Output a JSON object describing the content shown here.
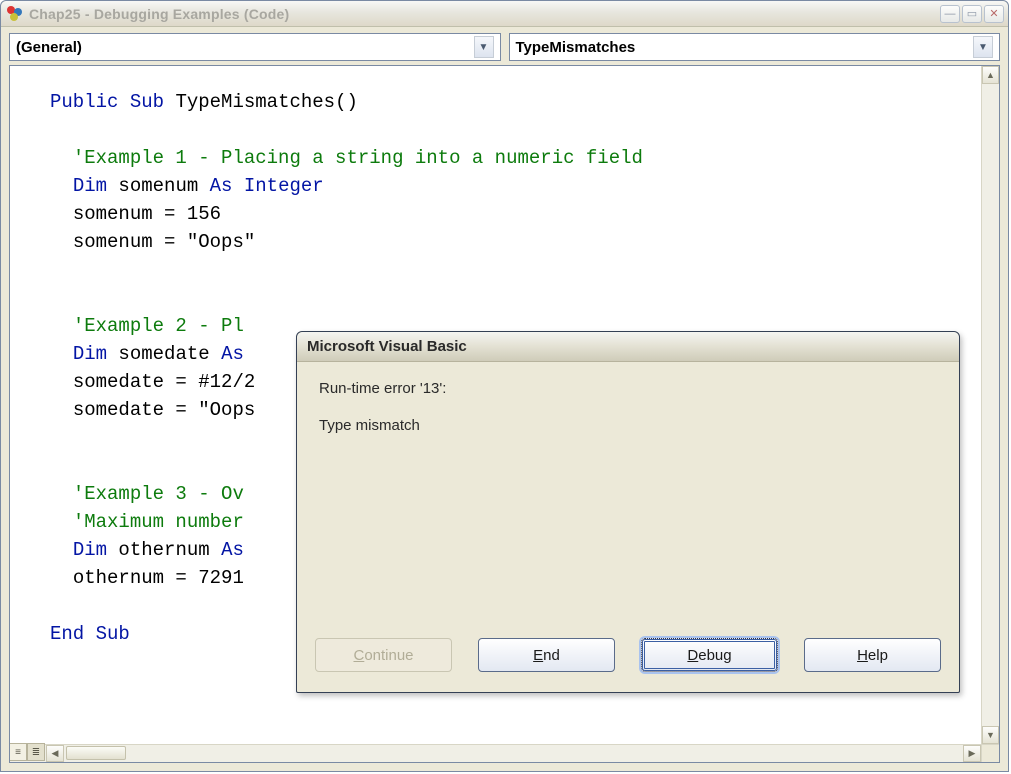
{
  "window": {
    "title": "Chap25 - Debugging Examples (Code)"
  },
  "dropdowns": {
    "left": "(General)",
    "right": "TypeMismatches"
  },
  "code": {
    "l1a": "Public",
    "l1b": "Sub",
    "l1c": " TypeMismatches()",
    "l2": "'Example 1 - Placing a string into a numeric field",
    "l3a": "Dim",
    "l3b": " somenum ",
    "l3c": "As Integer",
    "l4": "somenum = 156",
    "l5": "somenum = \"Oops\"",
    "l6": "'Example 2 - Pl",
    "l7a": "Dim",
    "l7b": " somedate ",
    "l7c": "As",
    "l8": "somedate = #12/2",
    "l9": "somedate = \"Oops",
    "l10": "'Example 3 - Ov",
    "l11": "'Maximum number",
    "l12a": "Dim",
    "l12b": " othernum ",
    "l12c": "As",
    "l13": "othernum = 7291",
    "l14a": "End",
    "l14b": "Sub"
  },
  "dialog": {
    "title": "Microsoft Visual Basic",
    "line1": "Run-time error '13':",
    "line2": "Type mismatch",
    "buttons": {
      "continue": "Continue",
      "end": "End",
      "debug": "Debug",
      "help": "Help"
    }
  }
}
